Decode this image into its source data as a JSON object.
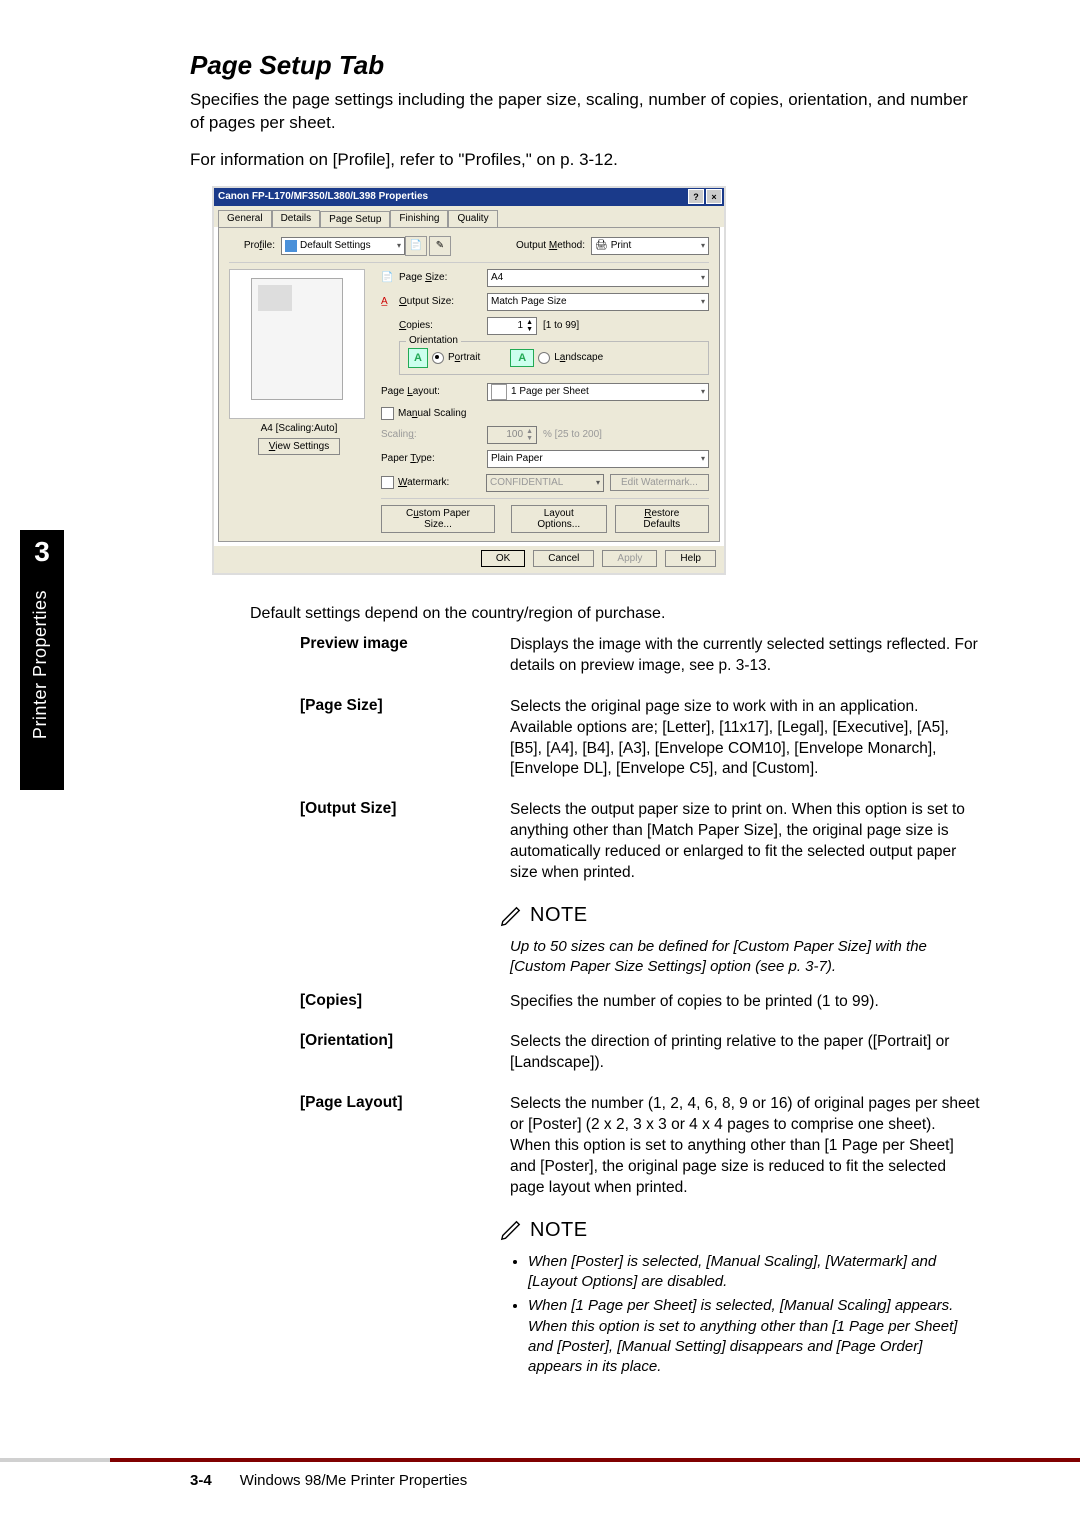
{
  "heading": "Page Setup Tab",
  "intro1": "Specifies the page settings including the paper size, scaling, number of copies, orientation, and number of pages per sheet.",
  "intro2": "For information on [Profile], refer to \"Profiles,\" on p. 3-12.",
  "side": {
    "num": "3",
    "label": "Printer Properties"
  },
  "dialog": {
    "title": "Canon FP-L170/MF350/L380/L398 Properties",
    "help_btn": "?",
    "close_btn": "×",
    "tabs": [
      "General",
      "Details",
      "Page Setup",
      "Finishing",
      "Quality"
    ],
    "active_tab": "Page Setup",
    "profile_label": "Profile:",
    "profile_value": "Default Settings",
    "output_method_label": "Output Method:",
    "output_method_value": "Print",
    "page_size_label": "Page Size:",
    "page_size_value": "A4",
    "output_size_label": "Output Size:",
    "output_size_value": "Match Page Size",
    "copies_label": "Copies:",
    "copies_value": "1",
    "copies_range": "[1 to 99]",
    "orientation_label": "Orientation",
    "portrait_label": "Portrait",
    "landscape_label": "Landscape",
    "page_layout_label": "Page Layout:",
    "page_layout_value": "1 Page per Sheet",
    "manual_scaling_label": "Manual Scaling",
    "scaling_label": "Scaling:",
    "scaling_value": "100",
    "scaling_range": "% [25 to 200]",
    "paper_type_label": "Paper Type:",
    "paper_type_value": "Plain Paper",
    "watermark_label": "Watermark:",
    "watermark_value": "CONFIDENTIAL",
    "edit_watermark_btn": "Edit Watermark...",
    "custom_paper_btn": "Custom Paper Size...",
    "layout_options_btn": "Layout Options...",
    "restore_defaults_btn": "Restore Defaults",
    "preview_caption": "A4 [Scaling:Auto]",
    "view_settings_btn": "View Settings",
    "ok_btn": "OK",
    "cancel_btn": "Cancel",
    "apply_btn": "Apply",
    "help_btn2": "Help"
  },
  "after_note": "Default settings depend on the country/region of purchase.",
  "defs": {
    "preview_image": {
      "term": "Preview image",
      "desc": "Displays the image with the currently selected settings reflected. For details on preview image, see p. 3-13."
    },
    "page_size": {
      "term": "[Page Size]",
      "desc": "Selects the original page size to work with in an application. Available options are; [Letter], [11x17], [Legal], [Executive], [A5], [B5], [A4], [B4], [A3], [Envelope COM10], [Envelope Monarch], [Envelope DL], [Envelope C5], and [Custom]."
    },
    "output_size": {
      "term": "[Output Size]",
      "desc": "Selects the output paper size to print on. When this option is set to anything other than [Match Paper Size], the original page size is automatically reduced or enlarged to fit the selected output paper size when printed."
    },
    "copies": {
      "term": "[Copies]",
      "desc": "Specifies the number of copies to be printed (1 to 99)."
    },
    "orientation": {
      "term": "[Orientation]",
      "desc": "Selects the direction of printing relative to the paper ([Portrait] or [Landscape])."
    },
    "page_layout": {
      "term": "[Page Layout]",
      "desc": "Selects the number (1, 2, 4, 6, 8, 9 or 16) of original pages per sheet or [Poster] (2 x 2, 3 x 3 or 4 x 4 pages to comprise one sheet). When this option is set to anything other than [1 Page per Sheet] and [Poster], the original page size is reduced to fit the selected page layout when printed."
    }
  },
  "note1": {
    "label": "NOTE",
    "body": "Up to 50 sizes can be defined for [Custom Paper Size] with the [Custom Paper Size Settings] option (see p. 3-7)."
  },
  "note2": {
    "label": "NOTE",
    "bullets": [
      "When [Poster] is selected, [Manual Scaling], [Watermark] and [Layout Options] are disabled.",
      "When [1 Page per Sheet] is selected, [Manual Scaling] appears.  When this option is set to anything other than [1 Page per Sheet] and [Poster], [Manual Setting] disappears and [Page Order] appears in its place."
    ]
  },
  "footer": {
    "page": "3-4",
    "text": "Windows 98/Me Printer Properties"
  }
}
